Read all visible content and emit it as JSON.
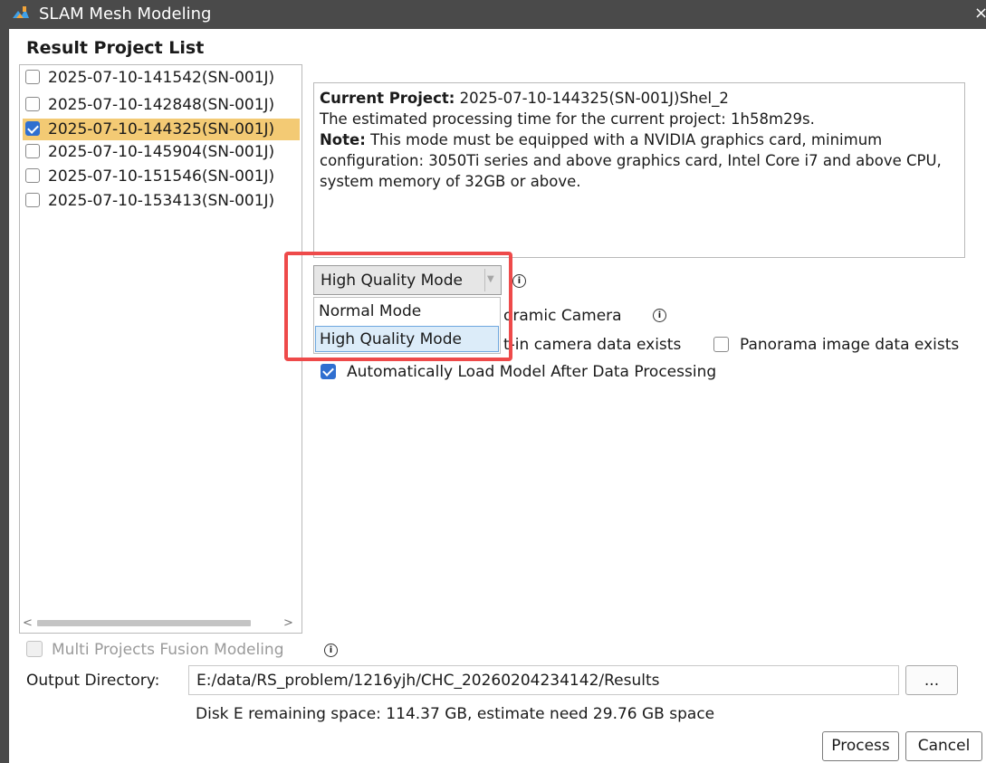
{
  "window": {
    "title": "SLAM Mesh Modeling",
    "close_glyph": "×",
    "app_icon": "slam-app-icon"
  },
  "project_list": {
    "title": "Result Project List",
    "items": [
      {
        "label": "2025-07-10-141542(SN-001J)",
        "checked": false,
        "selected": false
      },
      {
        "label": "2025-07-10-142848(SN-001J)",
        "checked": false,
        "selected": false
      },
      {
        "label": "2025-07-10-144325(SN-001J)",
        "checked": true,
        "selected": true
      },
      {
        "label": "2025-07-10-145904(SN-001J)",
        "checked": false,
        "selected": false
      },
      {
        "label": "2025-07-10-151546(SN-001J)",
        "checked": false,
        "selected": false
      },
      {
        "label": "2025-07-10-153413(SN-001J)",
        "checked": false,
        "selected": false
      }
    ],
    "scroll_left": "<",
    "scroll_right": ">"
  },
  "info": {
    "current_project_label": "Current Project:",
    "current_project_value": "2025-07-10-144325(SN-001J)Shel_2",
    "estimate_text": "The estimated processing time for the current project: 1h58m29s.",
    "note_label": "Note:",
    "note_text": "This mode must be equipped with a NVIDIA graphics card, minimum configuration: 3050Ti series and above graphics card, Intel Core i7 and above CPU, system memory of 32GB or above."
  },
  "mode": {
    "selected": "High Quality Mode",
    "options": [
      "Normal Mode",
      "High Quality Mode"
    ],
    "highlighted_index": 1
  },
  "options": {
    "panoramic_camera_partial": "oramic Camera",
    "builtin_partial": "t-in camera data exists",
    "builtin_checked": false,
    "panorama_image_label": "Panorama image data exists",
    "panorama_image_checked": false,
    "autoload_label": "Automatically Load Model After Data Processing",
    "autoload_checked": true
  },
  "multi_projects": {
    "label": "Multi Projects Fusion Modeling",
    "checked": false,
    "enabled": false
  },
  "output": {
    "label": "Output Directory:",
    "value": "E:/data/RS_problem/1216yjh/CHC_20260204234142/Results",
    "browse_label": "...",
    "disk_info": "Disk E remaining space: 114.37 GB, estimate need 29.76 GB space"
  },
  "buttons": {
    "process": "Process",
    "cancel": "Cancel"
  },
  "colors": {
    "titlebar": "#4a4a4a",
    "selection": "#f3ca74",
    "checkbox_checked": "#2f6fd0",
    "highlight_box": "#ee4a4a",
    "dropdown_hover": "#dcecf9"
  }
}
